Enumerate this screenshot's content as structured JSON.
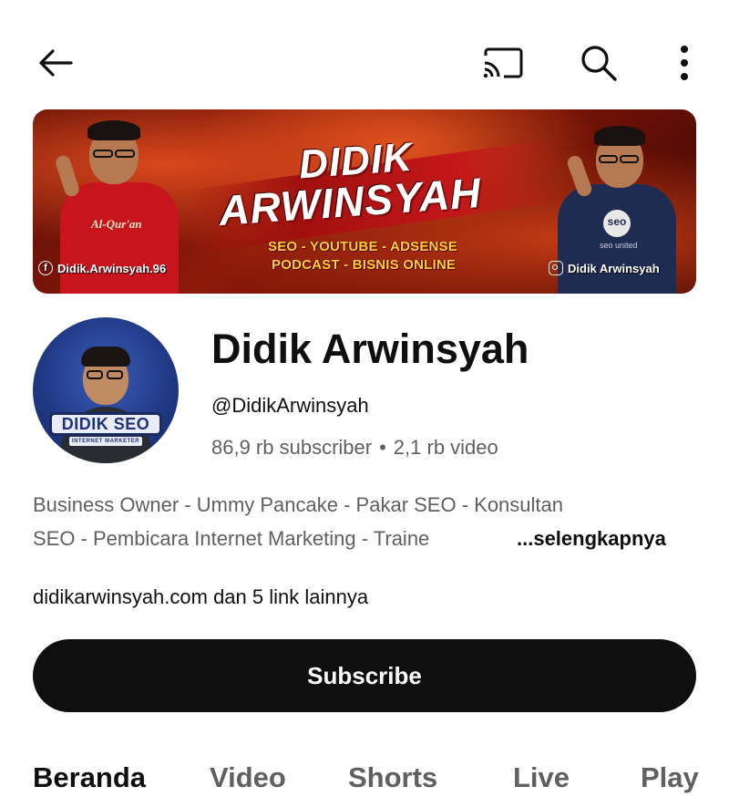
{
  "topbar": {
    "back_icon": "arrow-left-icon",
    "cast_icon": "cast-icon",
    "search_icon": "search-icon",
    "more_icon": "more-vert-icon"
  },
  "banner": {
    "title_line1": "DIDIK",
    "title_line2": "ARWINSYAH",
    "tagline1": "SEO - YOUTUBE - ADSENSE",
    "tagline2": "PODCAST - BISNIS ONLINE",
    "facebook": "Didik.Arwinsyah.96",
    "instagram": "Didik Arwinsyah",
    "shirt_left": "Al-Qur'an",
    "shirt_right_logo": "seo",
    "shirt_right_text": "seo united"
  },
  "avatar": {
    "badge": "DIDIK SEO",
    "sub": "INTERNET MARKETER"
  },
  "channel": {
    "name": "Didik Arwinsyah",
    "handle": "@DidikArwinsyah",
    "subscribers": "86,9 rb subscriber",
    "separator": "•",
    "videos": "2,1 rb video",
    "description_line1": "Business Owner - Ummy Pancake - Pakar SEO - Konsultan",
    "description_line2": "SEO - Pembicara Internet Marketing - Traine",
    "more_label": "...selengkapnya",
    "links": "didikarwinsyah.com dan 5 link lainnya",
    "subscribe_label": "Subscribe"
  },
  "tabs": [
    {
      "label": "Beranda",
      "active": true
    },
    {
      "label": "Video",
      "active": false
    },
    {
      "label": "Shorts",
      "active": false
    },
    {
      "label": "Live",
      "active": false
    },
    {
      "label": "Play",
      "active": false
    }
  ]
}
